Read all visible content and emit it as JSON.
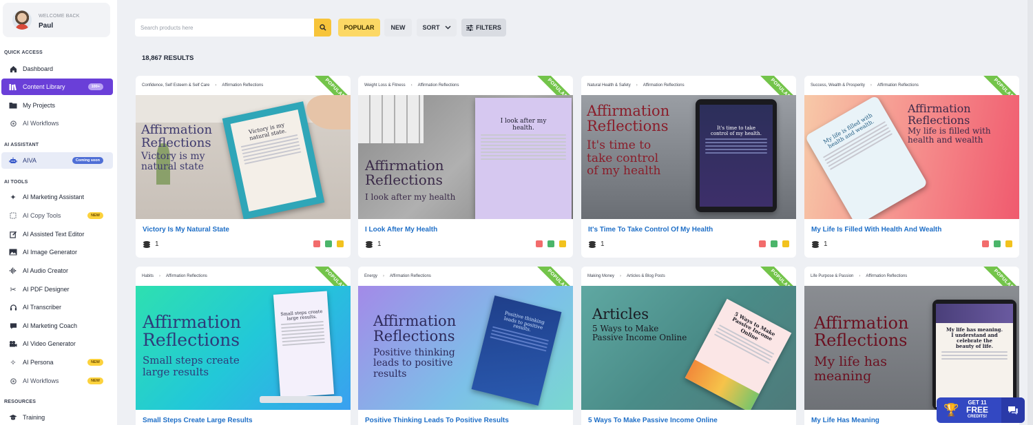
{
  "user": {
    "welcome": "WELCOME BACK",
    "name": "Paul"
  },
  "sidebar": {
    "sections": [
      {
        "label": "QUICK ACCESS",
        "items": [
          {
            "label": "Dashboard",
            "icon": "home-icon"
          },
          {
            "label": "Content Library",
            "icon": "library-icon",
            "badge": "100+",
            "active": true
          },
          {
            "label": "My Projects",
            "icon": "folder-icon"
          },
          {
            "label": "AI Workflows",
            "icon": "workflow-icon"
          }
        ]
      },
      {
        "label": "AI ASSISTANT",
        "items": [
          {
            "label": "AIVA",
            "icon": "robot-icon",
            "badge": "Coming soon"
          }
        ]
      },
      {
        "label": "AI TOOLS",
        "items": [
          {
            "label": "AI Marketing Assistant",
            "icon": "wand-icon"
          },
          {
            "label": "AI Copy Tools",
            "icon": "copy-icon",
            "badge": "NEW"
          },
          {
            "label": "AI Assisted Text Editor",
            "icon": "edit-icon"
          },
          {
            "label": "AI Image Generator",
            "icon": "image-icon"
          },
          {
            "label": "AI Audio Creator",
            "icon": "audio-icon"
          },
          {
            "label": "AI PDF Designer",
            "icon": "pdf-icon"
          },
          {
            "label": "AI Transcriber",
            "icon": "headset-icon"
          },
          {
            "label": "AI Marketing Coach",
            "icon": "chat-icon"
          },
          {
            "label": "AI Video Generator",
            "icon": "video-icon"
          },
          {
            "label": "AI Persona",
            "icon": "sparkle-icon",
            "badge": "NEW"
          },
          {
            "label": "AI Workflows",
            "icon": "workflow-icon",
            "badge": "NEW"
          }
        ]
      },
      {
        "label": "RESOURCES",
        "items": [
          {
            "label": "Training",
            "icon": "graduation-icon"
          }
        ]
      }
    ]
  },
  "toolbar": {
    "search_placeholder": "Search products here",
    "popular": "POPULAR",
    "new": "NEW",
    "sort": "SORT",
    "filters": "FILTERS"
  },
  "results_label": "18,867 RESULTS",
  "ribbon_label": "POPULAR",
  "cards": [
    {
      "crumb1": "Confidence, Self Esteem & Self Care",
      "crumb2": "Affirmation Reflections",
      "title": "Victory Is My Natural State",
      "count": "1",
      "head": "Affirmation\nReflections",
      "sub": "Victory is my\nnatural state",
      "paper": "Victory is my\nnatural state."
    },
    {
      "crumb1": "Weight Loss & Fitness",
      "crumb2": "Affirmation Reflections",
      "title": "I Look After My Health",
      "count": "1",
      "head": "Affirmation\nReflections",
      "sub": "I look after my health",
      "paper": "I look after my\nhealth."
    },
    {
      "crumb1": "Natural Health & Safety",
      "crumb2": "Affirmation Reflections",
      "title": "It's Time To Take Control Of My Health",
      "count": "1",
      "head": "Affirmation\nReflections",
      "sub": "It's time to\ntake control\nof my health",
      "paper": "It's time to take\ncontrol of my health."
    },
    {
      "crumb1": "Success, Wealth & Prosperity",
      "crumb2": "Affirmation Reflections",
      "title": "My Life Is Filled With Health And Wealth",
      "count": "1",
      "head": "Affirmation\nReflections",
      "sub": "My life is filled with\nhealth and wealth",
      "paper": "My life is filled with\nhealth and wealth."
    },
    {
      "crumb1": "Habits",
      "crumb2": "Affirmation Reflections",
      "title": "Small Steps Create Large Results",
      "head": "Affirmation\nReflections",
      "sub": "Small steps create\nlarge results",
      "paper": "Small steps create\nlarge results."
    },
    {
      "crumb1": "Energy",
      "crumb2": "Affirmation Reflections",
      "title": "Positive Thinking Leads To Positive Results",
      "head": "Affirmation\nReflections",
      "sub": "Positive thinking\nleads to positive\nresults",
      "paper": "Positive thinking\nleads to positive\nresults."
    },
    {
      "crumb1": "Making Money",
      "crumb2": "Articles & Blog Posts",
      "title": "5 Ways To Make Passive Income Online",
      "head": "Articles",
      "sub": "5 Ways to Make\nPassive Income Online",
      "paper": "5 Ways to Make\nPassive Income\nOnline"
    },
    {
      "crumb1": "Life Purpose & Passion",
      "crumb2": "Affirmation Reflections",
      "title": "My Life Has Meaning",
      "head": "Affirmation\nReflections",
      "sub": "My life has\nmeaning",
      "paper": "My life has meaning.\nI understand and\ncelebrate the\nbeauty of life."
    }
  ],
  "promo": {
    "line1": "GET 11",
    "line2": "FREE",
    "line3": "CREDITS!"
  },
  "colors": {
    "accent": "#6a3fd8",
    "link": "#1f6fc7",
    "popular": "#fcd865",
    "ribbon": "#73c44a",
    "promo": "#3348c2"
  }
}
